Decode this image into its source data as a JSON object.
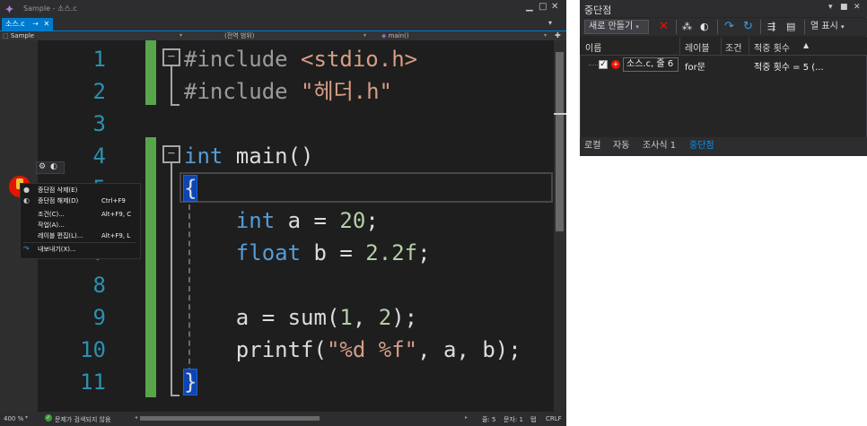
{
  "editor": {
    "title": "Sample - 소스.c",
    "tab": {
      "label": "소스.c",
      "pin_icon": "pin-icon",
      "close_icon": "close-icon"
    },
    "nav": {
      "project": "Sample",
      "scope": "(전역 범위)",
      "function": "main()"
    },
    "lines": [
      "1",
      "2",
      "3",
      "4",
      "5",
      "6",
      "7",
      "8",
      "9",
      "10",
      "11"
    ],
    "code": {
      "l1": {
        "directive": "#include",
        "target": " <stdio.h>"
      },
      "l2": {
        "directive": "#include",
        "target": " \"헤더.h\""
      },
      "l4": {
        "keyword": "int",
        "rest": " main()"
      },
      "l5": {
        "brace": "{"
      },
      "l6": {
        "keyword": "int",
        "rest": " a = ",
        "number": "20",
        "end": ";"
      },
      "l7": {
        "keyword": "float",
        "rest": " b = ",
        "number": "2.2f",
        "end": ";"
      },
      "l9": {
        "rest": "a = sum(",
        "n1": "1",
        "mid": ", ",
        "n2": "2",
        "end": ");"
      },
      "l10": {
        "rest": "printf(",
        "str": "\"%d %f\"",
        "end": ", a, b);"
      },
      "l11": {
        "brace": "}"
      }
    },
    "context_menu": [
      {
        "label": "중단점 삭제(E)",
        "shortcut": "",
        "icon": "delete-breakpoint-icon"
      },
      {
        "label": "중단점 해제(D)",
        "shortcut": "Ctrl+F9",
        "icon": "disable-breakpoint-icon"
      },
      {
        "label": "조건(C)...",
        "shortcut": "Alt+F9, C",
        "icon": ""
      },
      {
        "label": "작업(A)...",
        "shortcut": "",
        "icon": ""
      },
      {
        "label": "레이블 편집(L)...",
        "shortcut": "Alt+F9, L",
        "icon": ""
      },
      {
        "label": "내보내기(X)...",
        "shortcut": "",
        "icon": "export-icon"
      }
    ],
    "status": {
      "zoom": "400 %",
      "issues": "문제가 검색되지 않음",
      "line": "줄: 5",
      "column": "문자: 1",
      "tab_mode": "탭",
      "eol": "CRLF"
    }
  },
  "breakpoints_window": {
    "title": "중단점",
    "toolbar": {
      "new_label": "새로 만들기",
      "columns_label": "열 표시"
    },
    "columns": [
      "이름",
      "레이블",
      "조건",
      "적중 횟수"
    ],
    "rows": [
      {
        "checked": true,
        "name": "소스.c, 줄 6",
        "label": "for문",
        "condition": "",
        "hit_count": "적중 횟수 = 5 (..."
      }
    ],
    "tabs": [
      "로컬",
      "자동",
      "조사식 1",
      "중단점"
    ],
    "active_tab": "중단점"
  },
  "colors": {
    "accent": "#007acc",
    "keyword": "#569cd6",
    "string": "#d69d85",
    "line_number": "#2b91af",
    "change_bar": "#57a64a",
    "breakpoint": "#e51400"
  }
}
